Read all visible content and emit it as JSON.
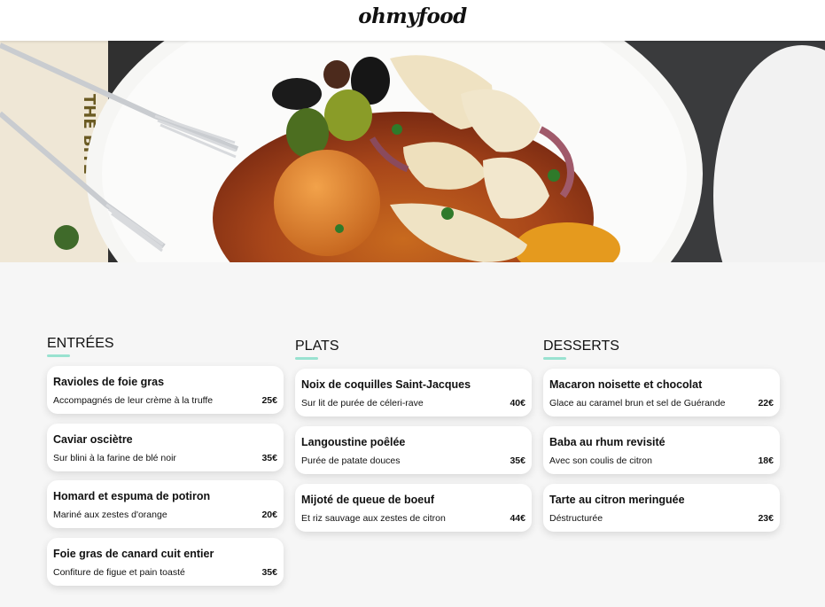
{
  "header": {
    "logo": "ohmyfood"
  },
  "hero": {
    "alt": "food-photo"
  },
  "menu": {
    "columns": [
      {
        "title": "ENTRÉES",
        "items": [
          {
            "name": "Ravioles de foie gras",
            "desc": "Accompagnés de leur crème à la truffe",
            "price": "25€"
          },
          {
            "name": "Caviar osciètre",
            "desc": "Sur blini à la farine de blé noir",
            "price": "35€"
          },
          {
            "name": "Homard et espuma de potiron",
            "desc": "Mariné aux zestes d'orange",
            "price": "20€"
          },
          {
            "name": "Foie gras de canard cuit entier",
            "desc": "Confiture de figue et pain toasté",
            "price": "35€"
          }
        ]
      },
      {
        "title": "PLATS",
        "items": [
          {
            "name": "Noix de coquilles Saint-Jacques",
            "desc": "Sur lit de purée de céleri-rave",
            "price": "40€"
          },
          {
            "name": "Langoustine poêlée",
            "desc": "Purée de patate douces",
            "price": "35€"
          },
          {
            "name": "Mijoté de queue de boeuf",
            "desc": "Et riz sauvage aux zestes de citron",
            "price": "44€"
          }
        ]
      },
      {
        "title": "DESSERTS",
        "items": [
          {
            "name": "Macaron noisette et chocolat",
            "desc": "Glace au caramel brun et sel de Guérande",
            "price": "22€"
          },
          {
            "name": "Baba au rhum revisité",
            "desc": "Avec son coulis de citron",
            "price": "18€"
          },
          {
            "name": "Tarte au citron meringuée",
            "desc": "Déstructurée",
            "price": "23€"
          }
        ]
      }
    ]
  },
  "colors": {
    "accent": "#99e2d0",
    "background": "#f6f6f6"
  }
}
